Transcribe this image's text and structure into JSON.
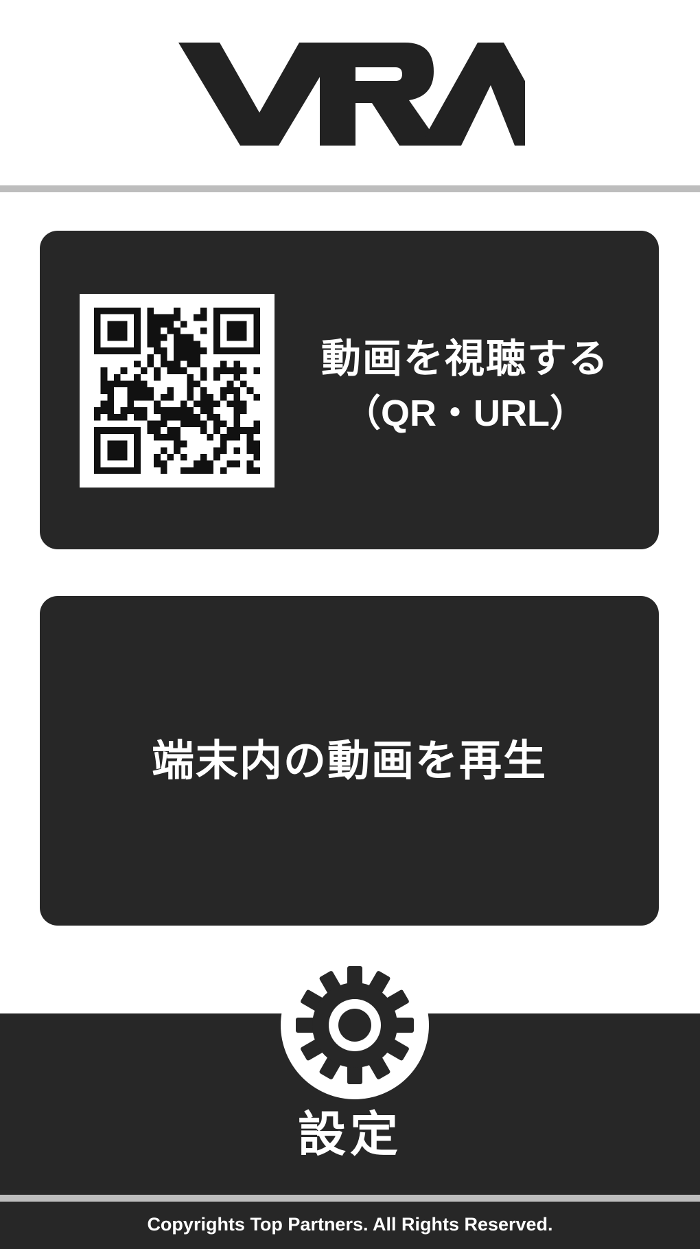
{
  "header": {
    "logo_text": "VRA"
  },
  "menu": {
    "watch_video": {
      "line1": "動画を視聴する",
      "line2": "（QR・URL）",
      "icon": "qr-code-icon"
    },
    "play_local": {
      "label": "端末内の動画を再生"
    }
  },
  "settings": {
    "label": "設定",
    "icon": "gear-icon"
  },
  "footer": {
    "copyright": "Copyrights Top Partners. All Rights Reserved."
  },
  "colors": {
    "panel": "#272727",
    "divider": "#bdbdbd",
    "background": "#ffffff",
    "text_on_panel": "#ffffff"
  }
}
